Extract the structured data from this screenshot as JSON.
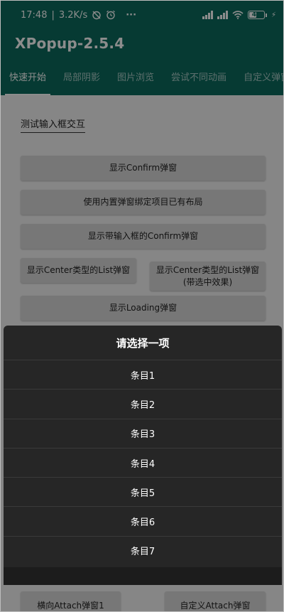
{
  "status_bar": {
    "time": "17:48",
    "speed": "3.2K/s",
    "icons": [
      "alarm-off-icon",
      "alarm-icon",
      "more-icon",
      "signal-icon",
      "signal-icon",
      "wifi-icon",
      "battery-icon",
      "charging-icon"
    ],
    "more": "···",
    "battery": "40",
    "charging": "⚡"
  },
  "app_bar": {
    "title": "XPopup-2.5.4"
  },
  "tabs": [
    {
      "label": "快速开始"
    },
    {
      "label": "局部阴影"
    },
    {
      "label": "图片浏览"
    },
    {
      "label": "尝试不同动画"
    },
    {
      "label": "自定义弹窗"
    }
  ],
  "content": {
    "input_link": "测试输入框交互",
    "buttons": {
      "confirm": "显示Confirm弹窗",
      "bind_layout": "使用内置弹窗绑定项目已有布局",
      "input_confirm": "显示带输入框的Confirm弹窗",
      "center_list": "显示Center类型的List弹窗",
      "center_list_checked_line1": "显示Center类型的List弹窗",
      "center_list_checked_line2": "(带选中效果)",
      "loading": "显示Loading弹窗",
      "attach_horizontal": "横向Attach弹窗1",
      "attach_custom": "自定义Attach弹窗"
    }
  },
  "bottom_sheet": {
    "title": "请选择一项",
    "items": [
      "条目1",
      "条目2",
      "条目3",
      "条目4",
      "条目5",
      "条目6",
      "条目7"
    ]
  },
  "colors": {
    "primary": "#0b6b5e",
    "sheet_bg": "#262626"
  }
}
